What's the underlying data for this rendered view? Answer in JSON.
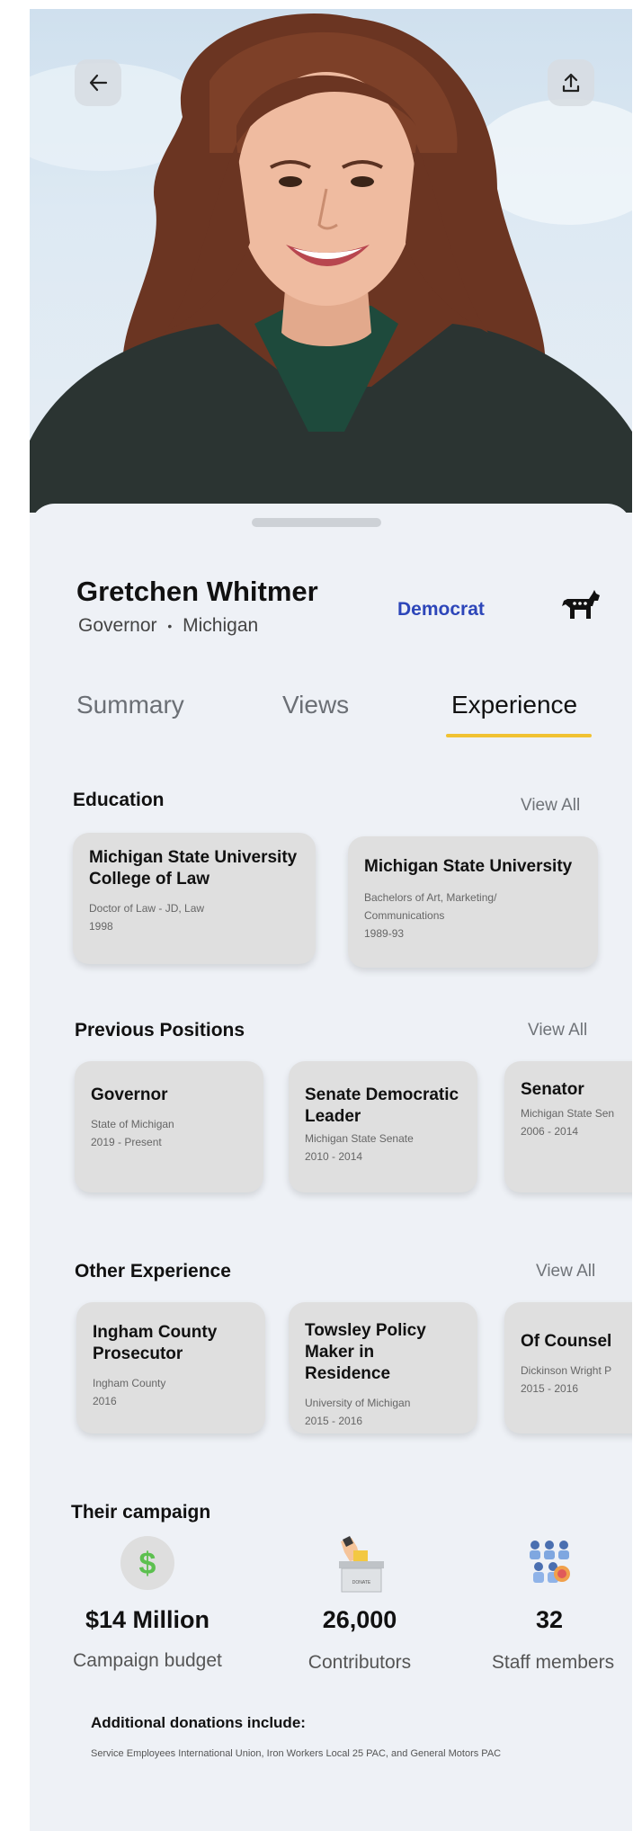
{
  "header": {
    "back_icon": "arrow-left-icon",
    "share_icon": "share-upload-icon"
  },
  "profile": {
    "name": "Gretchen Whitmer",
    "role": "Governor",
    "separator": "•",
    "state": "Michigan",
    "party": "Democrat",
    "party_icon": "donkey-icon"
  },
  "tabs": [
    {
      "label": "Summary",
      "active": false
    },
    {
      "label": "Views",
      "active": false
    },
    {
      "label": "Experience",
      "active": true
    }
  ],
  "education": {
    "title": "Education",
    "view_all": "View All",
    "items": [
      {
        "title": "Michigan State University College of Law",
        "line1": "Doctor of Law - JD, Law",
        "line2": "1998"
      },
      {
        "title": "Michigan State University",
        "line1": "Bachelors of Art, Marketing/",
        "line2": "Communications",
        "line3": "1989-93"
      }
    ]
  },
  "positions": {
    "title": "Previous Positions",
    "view_all": "View All",
    "items": [
      {
        "title": "Governor",
        "line1": "State of Michigan",
        "line2": "2019 - Present"
      },
      {
        "title": "Senate Democratic Leader",
        "line1": "Michigan State Senate",
        "line2": "2010 - 2014"
      },
      {
        "title": "Senator",
        "line1": "Michigan State Sen",
        "line2": "2006 - 2014"
      }
    ]
  },
  "other": {
    "title": "Other Experience",
    "view_all": "View All",
    "items": [
      {
        "title": "Ingham County Prosecutor",
        "line1": "Ingham County",
        "line2": "2016"
      },
      {
        "title": "Towsley Policy Maker in Residence",
        "line1": "University of Michigan",
        "line2": "2015 - 2016"
      },
      {
        "title": "Of Counsel",
        "line1": "Dickinson Wright P",
        "line2": "2015 - 2016"
      }
    ]
  },
  "campaign": {
    "title": "Their campaign",
    "stats": [
      {
        "value": "$14 Million",
        "label": "Campaign budget",
        "icon": "dollar-icon"
      },
      {
        "value": "26,000",
        "label": "Contributors",
        "icon": "ballot-box-icon",
        "icon_text": "DONATE"
      },
      {
        "value": "32",
        "label": "Staff members",
        "icon": "staff-group-icon"
      }
    ],
    "donations_title": "Additional donations include:",
    "donations_text": "Service Employees International Union, Iron Workers Local 25 PAC, and General Motors PAC"
  },
  "colors": {
    "party": "#2d46b9",
    "tab_accent": "#f1c232",
    "card_bg": "#dfdfdf",
    "sheet_bg": "#eef1f6"
  }
}
